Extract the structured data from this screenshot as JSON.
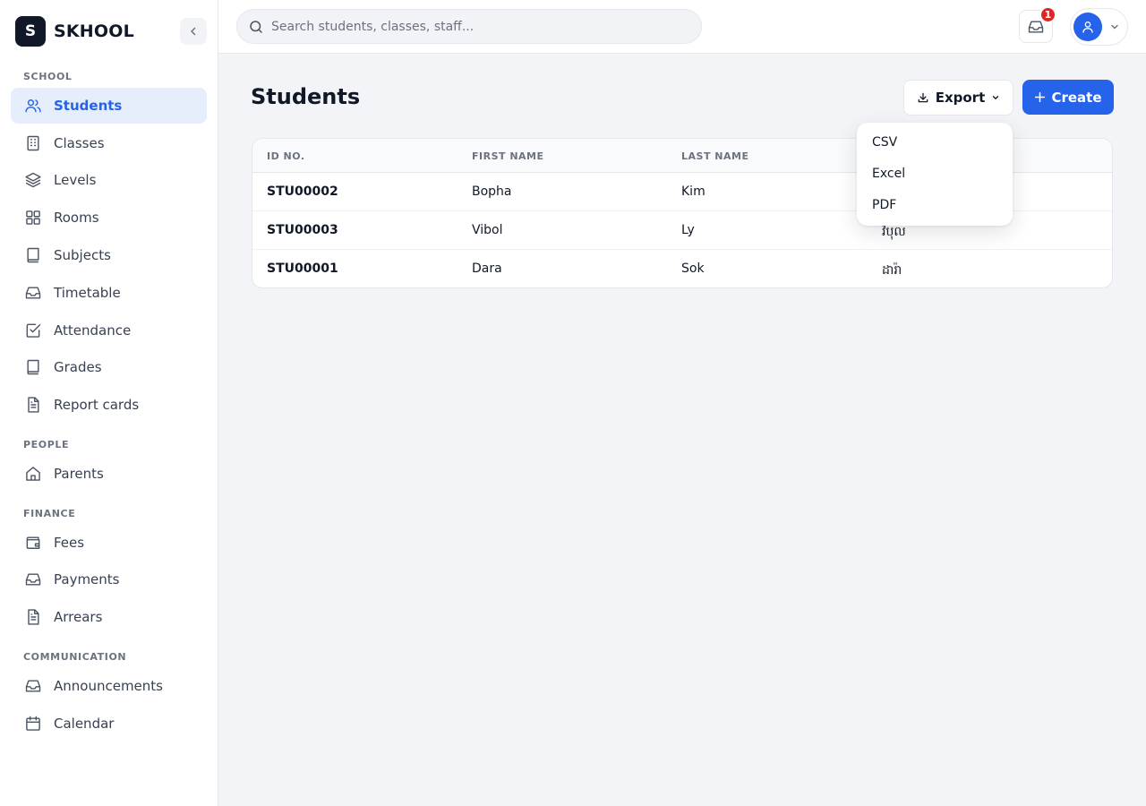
{
  "brand": {
    "logo_letter": "S",
    "name": "SKHOOL"
  },
  "search": {
    "placeholder": "Search students, classes, staff..."
  },
  "notifications": {
    "count": "1"
  },
  "sidebar": {
    "sections": [
      {
        "label": "SCHOOL"
      },
      {
        "label": "PEOPLE"
      },
      {
        "label": "FINANCE"
      },
      {
        "label": "COMMUNICATION"
      }
    ],
    "items": [
      {
        "label": "Students",
        "icon": "users-icon",
        "active": true
      },
      {
        "label": "Classes",
        "icon": "building-icon"
      },
      {
        "label": "Levels",
        "icon": "layers-icon"
      },
      {
        "label": "Rooms",
        "icon": "grid-icon"
      },
      {
        "label": "Subjects",
        "icon": "book-icon"
      },
      {
        "label": "Timetable",
        "icon": "inbox-icon"
      },
      {
        "label": "Attendance",
        "icon": "checkbox-icon"
      },
      {
        "label": "Grades",
        "icon": "book-icon"
      },
      {
        "label": "Report cards",
        "icon": "document-icon"
      },
      {
        "label": "Parents",
        "icon": "home-icon"
      },
      {
        "label": "Fees",
        "icon": "wallet-icon"
      },
      {
        "label": "Payments",
        "icon": "inbox-icon"
      },
      {
        "label": "Arrears",
        "icon": "document-icon"
      },
      {
        "label": "Announcements",
        "icon": "inbox-icon"
      },
      {
        "label": "Calendar",
        "icon": "calendar-icon"
      }
    ]
  },
  "main": {
    "title": "Students",
    "export_label": "Export",
    "create_label": "Create",
    "export_menu": [
      "CSV",
      "Excel",
      "PDF"
    ],
    "table": {
      "columns": [
        "ID NO.",
        "FIRST NAME",
        "LAST NAME",
        ""
      ],
      "rows": [
        [
          "STU00002",
          "Bopha",
          "Kim",
          ""
        ],
        [
          "STU00003",
          "Vibol",
          "Ly",
          "វិបុល"
        ],
        [
          "STU00001",
          "Dara",
          "Sok",
          "ដារ៉ា"
        ]
      ]
    }
  },
  "colors": {
    "accent": "#2563eb",
    "active_bg": "#e6eefc",
    "badge": "#dc2626"
  }
}
